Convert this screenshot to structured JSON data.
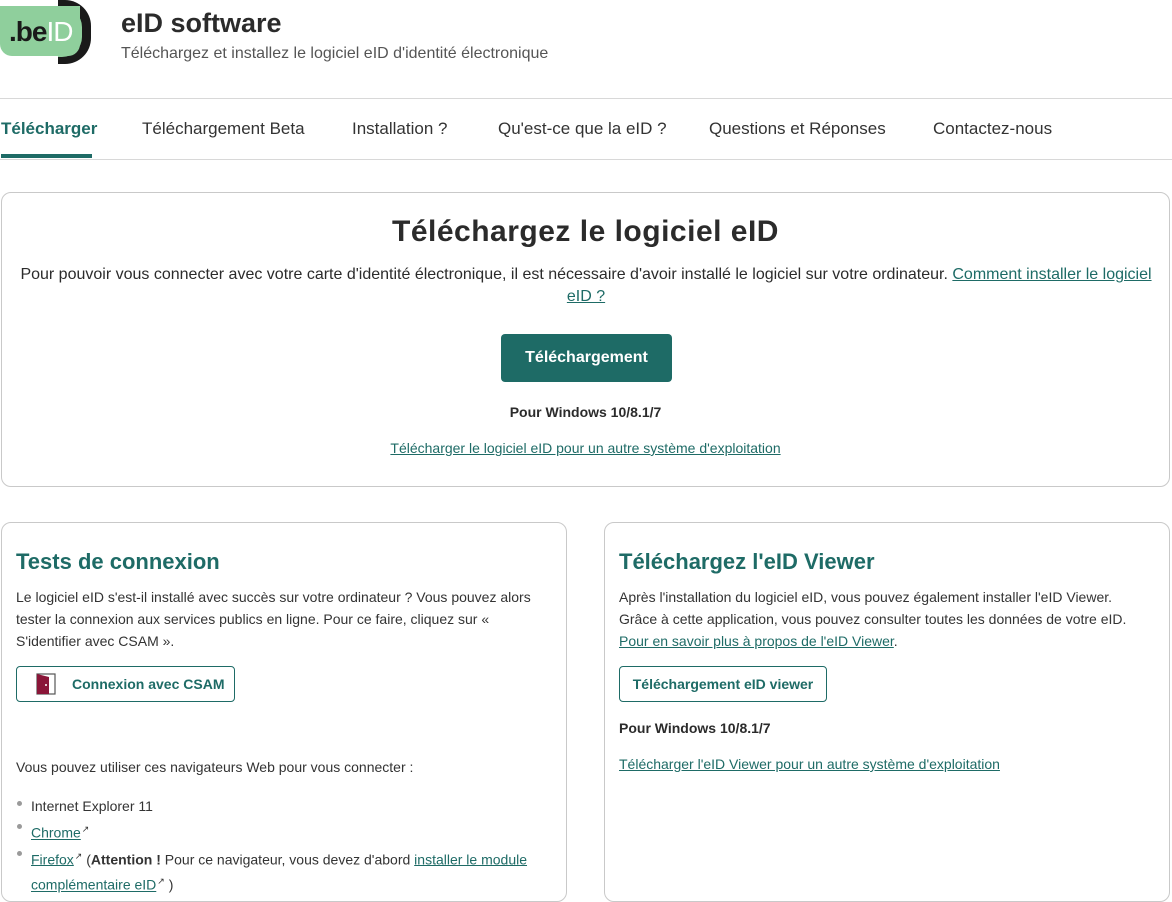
{
  "header": {
    "logo_text_be": ".be",
    "logo_text_id": "ID",
    "title": "eID software",
    "subtitle": "Téléchargez et installez le logiciel eID d'identité électronique"
  },
  "nav": {
    "items": [
      {
        "label": "Télécharger",
        "active": true
      },
      {
        "label": "Téléchargement Beta",
        "active": false
      },
      {
        "label": "Installation ?",
        "active": false
      },
      {
        "label": "Qu'est-ce que la eID ?",
        "active": false
      },
      {
        "label": "Questions et Réponses",
        "active": false
      },
      {
        "label": "Contactez-nous",
        "active": false
      }
    ]
  },
  "main": {
    "title": "Téléchargez le logiciel eID",
    "description": "Pour pouvoir vous connecter avec votre carte d'identité électronique, il est nécessaire d'avoir installé le logiciel sur votre ordinateur. ",
    "install_link": "Comment installer le logiciel eID ?",
    "download_button": "Téléchargement",
    "os_note": "Pour Windows 10/8.1/7",
    "other_os_link": "Télécharger le logiciel eID pour un autre système d'exploitation"
  },
  "connection": {
    "title": "Tests de connexion",
    "text": "Le logiciel eID s'est-il installé avec succès sur votre ordinateur ? Vous pouvez alors tester la connexion aux services publics en ligne. Pour ce faire, cliquez sur « S'identifier avec CSAM ».",
    "csam_button": "Connexion avec CSAM",
    "browsers_intro": "Vous pouvez utiliser ces navigateurs Web pour vous connecter :",
    "browsers": {
      "ie": "Internet Explorer 11",
      "chrome": "Chrome",
      "firefox": "Firefox",
      "firefox_open": " (",
      "attention": "Attention !",
      "firefox_note": " Pour ce navigateur, vous devez d'abord ",
      "module_link": "installer le module complémentaire eID",
      "firefox_close": " )"
    },
    "external_icon": "↗"
  },
  "viewer": {
    "title": "Téléchargez l'eID Viewer",
    "text": "Après l'installation du logiciel eID, vous pouvez également installer l'eID Viewer. Grâce à cette application, vous pouvez consulter toutes les données de votre eID. ",
    "more_link": "Pour en savoir plus à propos de l'eID Viewer",
    "text_end": ".",
    "download_button": "Téléchargement eID viewer",
    "os_note": "Pour Windows 10/8.1/7",
    "other_os_link": "Télécharger l'eID Viewer pour un autre système d'exploitation "
  },
  "colors": {
    "accent": "#1e6b66",
    "logo_green": "#8fcf9c",
    "door_red": "#8a1538"
  }
}
